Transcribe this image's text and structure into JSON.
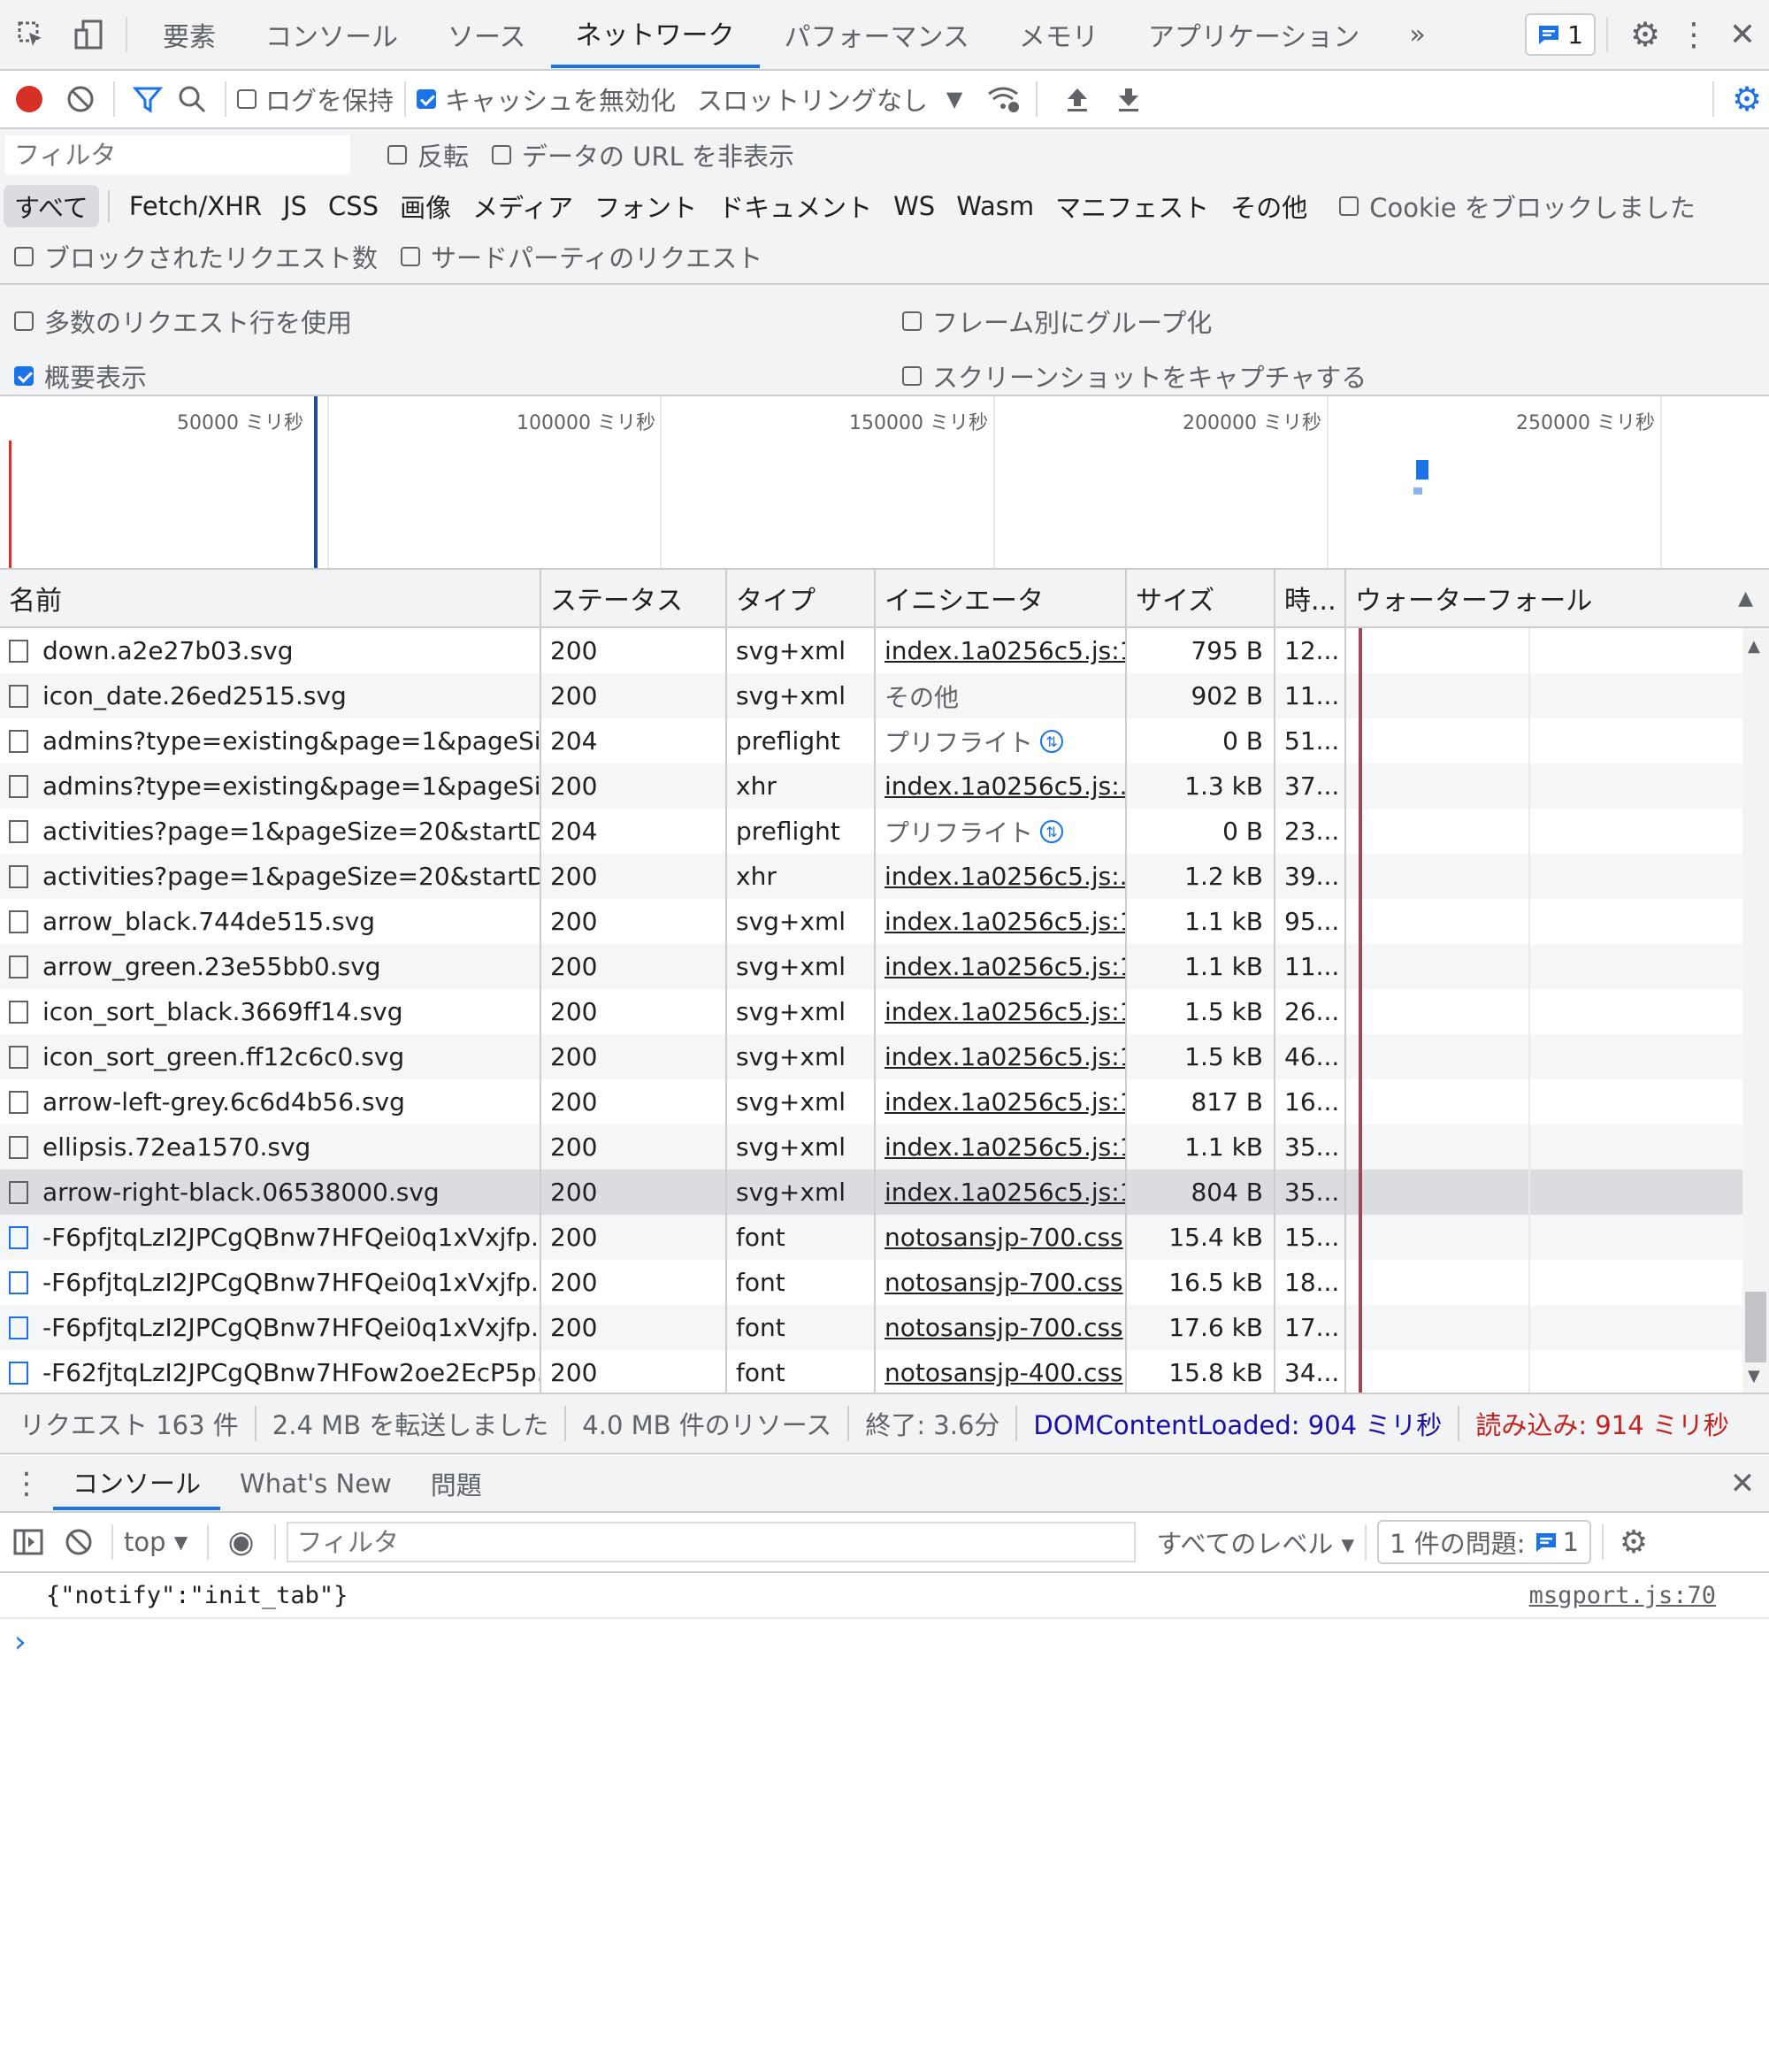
{
  "tabs": {
    "items": [
      "要素",
      "コンソール",
      "ソース",
      "ネットワーク",
      "パフォーマンス",
      "メモリ",
      "アプリケーション"
    ],
    "more": "»",
    "issues_badge": "1"
  },
  "toolbar": {
    "preserve_log": "ログを保持",
    "disable_cache": "キャッシュを無効化",
    "throttling": "スロットリングなし"
  },
  "filter": {
    "placeholder": "フィルタ",
    "invert": "反転",
    "hide_data_urls": "データの URL を非表示",
    "types": [
      "すべて",
      "Fetch/XHR",
      "JS",
      "CSS",
      "画像",
      "メディア",
      "フォント",
      "ドキュメント",
      "WS",
      "Wasm",
      "マニフェスト",
      "その他"
    ],
    "blocked_cookies": "Cookie をブロックしました",
    "blocked_requests": "ブロックされたリクエスト数",
    "third_party": "サードパーティのリクエスト"
  },
  "settings": {
    "big_request_rows": "多数のリクエスト行を使用",
    "group_by_frame": "フレーム別にグループ化",
    "show_overview": "概要表示",
    "capture_screenshots": "スクリーンショットをキャプチャする"
  },
  "overview": {
    "ticks": [
      "50000 ミリ秒",
      "100000 ミリ秒",
      "150000 ミリ秒",
      "200000 ミリ秒",
      "250000 ミリ秒"
    ]
  },
  "table": {
    "headers": [
      "名前",
      "ステータス",
      "タイプ",
      "イニシエータ",
      "サイズ",
      "時...",
      "ウォーターフォール"
    ],
    "rows": [
      {
        "name": "down.a2e27b03.svg",
        "status": "200",
        "type": "svg+xml",
        "initiator": "index.1a0256c5.js:1",
        "size": "795 B",
        "time": "12...",
        "icon": "svg"
      },
      {
        "name": "icon_date.26ed2515.svg",
        "status": "200",
        "type": "svg+xml",
        "initiator": "その他",
        "size": "902 B",
        "time": "11...",
        "icon": "svg"
      },
      {
        "name": "admins?type=existing&page=1&pageSi...",
        "status": "204",
        "type": "preflight",
        "initiator": "プリフライト",
        "size": "0 B",
        "time": "51...",
        "icon": "doc"
      },
      {
        "name": "admins?type=existing&page=1&pageSi...",
        "status": "200",
        "type": "xhr",
        "initiator": "index.1a0256c5.js:...",
        "size": "1.3 kB",
        "time": "37...",
        "icon": "doc"
      },
      {
        "name": "activities?page=1&pageSize=20&startD...",
        "status": "204",
        "type": "preflight",
        "initiator": "プリフライト",
        "size": "0 B",
        "time": "23...",
        "icon": "doc"
      },
      {
        "name": "activities?page=1&pageSize=20&startD...",
        "status": "200",
        "type": "xhr",
        "initiator": "index.1a0256c5.js:...",
        "size": "1.2 kB",
        "time": "39...",
        "icon": "doc"
      },
      {
        "name": "arrow_black.744de515.svg",
        "status": "200",
        "type": "svg+xml",
        "initiator": "index.1a0256c5.js:1",
        "size": "1.1 kB",
        "time": "95...",
        "icon": "svg"
      },
      {
        "name": "arrow_green.23e55bb0.svg",
        "status": "200",
        "type": "svg+xml",
        "initiator": "index.1a0256c5.js:1",
        "size": "1.1 kB",
        "time": "11...",
        "icon": "svg"
      },
      {
        "name": "icon_sort_black.3669ff14.svg",
        "status": "200",
        "type": "svg+xml",
        "initiator": "index.1a0256c5.js:1",
        "size": "1.5 kB",
        "time": "26...",
        "icon": "svg"
      },
      {
        "name": "icon_sort_green.ff12c6c0.svg",
        "status": "200",
        "type": "svg+xml",
        "initiator": "index.1a0256c5.js:1",
        "size": "1.5 kB",
        "time": "46...",
        "icon": "svg"
      },
      {
        "name": "arrow-left-grey.6c6d4b56.svg",
        "status": "200",
        "type": "svg+xml",
        "initiator": "index.1a0256c5.js:1",
        "size": "817 B",
        "time": "16...",
        "icon": "svg"
      },
      {
        "name": "ellipsis.72ea1570.svg",
        "status": "200",
        "type": "svg+xml",
        "initiator": "index.1a0256c5.js:1",
        "size": "1.1 kB",
        "time": "35...",
        "icon": "svg"
      },
      {
        "name": "arrow-right-black.06538000.svg",
        "status": "200",
        "type": "svg+xml",
        "initiator": "index.1a0256c5.js:1",
        "size": "804 B",
        "time": "35...",
        "icon": "svg",
        "selected": true
      },
      {
        "name": "-F6pfjtqLzI2JPCgQBnw7HFQei0q1xVxjfp...",
        "status": "200",
        "type": "font",
        "initiator": "notosansjp-700.css",
        "size": "15.4 kB",
        "time": "15...",
        "icon": "font"
      },
      {
        "name": "-F6pfjtqLzI2JPCgQBnw7HFQei0q1xVxjfp...",
        "status": "200",
        "type": "font",
        "initiator": "notosansjp-700.css",
        "size": "16.5 kB",
        "time": "18...",
        "icon": "font"
      },
      {
        "name": "-F6pfjtqLzI2JPCgQBnw7HFQei0q1xVxjfp...",
        "status": "200",
        "type": "font",
        "initiator": "notosansjp-700.css",
        "size": "17.6 kB",
        "time": "17...",
        "icon": "font"
      },
      {
        "name": "-F62fjtqLzI2JPCgQBnw7HFow2oe2EcP5p...",
        "status": "200",
        "type": "font",
        "initiator": "notosansjp-400.css",
        "size": "15.8 kB",
        "time": "34...",
        "icon": "font"
      }
    ]
  },
  "summary": {
    "requests": "リクエスト 163 件",
    "transferred": "2.4 MB を転送しました",
    "resources": "4.0 MB 件のリソース",
    "finish": "終了: 3.6分",
    "dcl": "DOMContentLoaded: 904 ミリ秒",
    "load": "読み込み: 914 ミリ秒"
  },
  "drawer": {
    "tabs": [
      "コンソール",
      "What's New",
      "問題"
    ],
    "context": "top",
    "filter_placeholder": "フィルタ",
    "levels": "すべてのレベル ▾",
    "issues": "1 件の問題:",
    "issues_count": "1",
    "log_text": "{\"notify\":\"init_tab\"}",
    "log_source": "msgport.js:70",
    "prompt": "›"
  },
  "colors": {
    "accent": "#1a73e8",
    "record": "#d93025",
    "load": "#c5221f",
    "dcl": "#1a0dab"
  }
}
